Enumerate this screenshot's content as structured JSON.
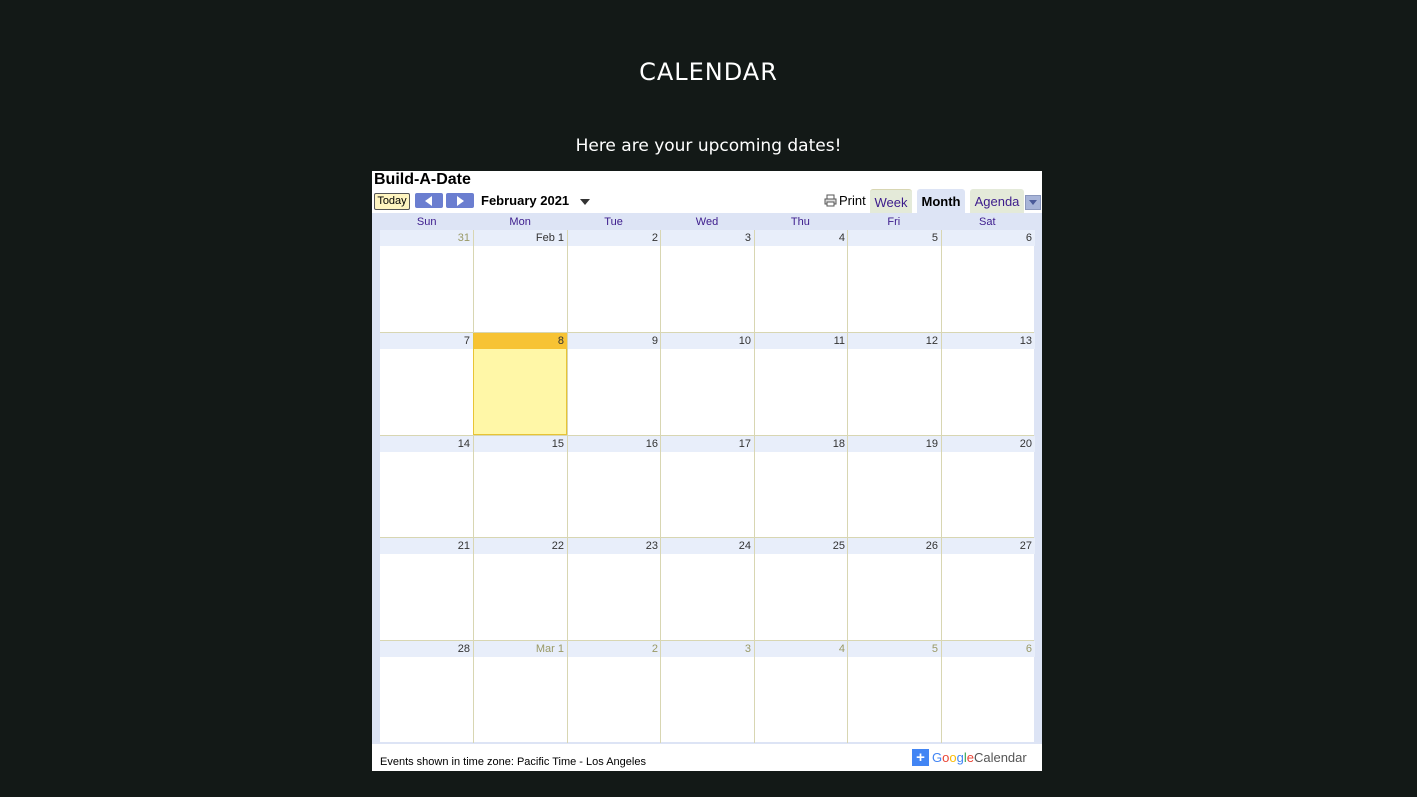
{
  "page": {
    "title": "CALENDAR",
    "subtitle": "Here are your upcoming dates!"
  },
  "calendar": {
    "name": "Build-A-Date",
    "today_label": "Today",
    "month_label": "February 2021",
    "print_label": "Print",
    "tabs": {
      "week": "Week",
      "month": "Month",
      "agenda": "Agenda"
    },
    "active_tab": "Month",
    "day_names": [
      "Sun",
      "Mon",
      "Tue",
      "Wed",
      "Thu",
      "Fri",
      "Sat"
    ],
    "weeks": [
      [
        {
          "label": "31",
          "other": true
        },
        {
          "label": "Feb 1",
          "other": false
        },
        {
          "label": "2",
          "other": false
        },
        {
          "label": "3",
          "other": false
        },
        {
          "label": "4",
          "other": false
        },
        {
          "label": "5",
          "other": false
        },
        {
          "label": "6",
          "other": false
        }
      ],
      [
        {
          "label": "7",
          "other": false
        },
        {
          "label": "8",
          "other": false,
          "today": true
        },
        {
          "label": "9",
          "other": false
        },
        {
          "label": "10",
          "other": false
        },
        {
          "label": "11",
          "other": false
        },
        {
          "label": "12",
          "other": false
        },
        {
          "label": "13",
          "other": false
        }
      ],
      [
        {
          "label": "14",
          "other": false
        },
        {
          "label": "15",
          "other": false
        },
        {
          "label": "16",
          "other": false
        },
        {
          "label": "17",
          "other": false
        },
        {
          "label": "18",
          "other": false
        },
        {
          "label": "19",
          "other": false
        },
        {
          "label": "20",
          "other": false
        }
      ],
      [
        {
          "label": "21",
          "other": false
        },
        {
          "label": "22",
          "other": false
        },
        {
          "label": "23",
          "other": false
        },
        {
          "label": "24",
          "other": false
        },
        {
          "label": "25",
          "other": false
        },
        {
          "label": "26",
          "other": false
        },
        {
          "label": "27",
          "other": false
        }
      ],
      [
        {
          "label": "28",
          "other": false
        },
        {
          "label": "Mar 1",
          "other": true
        },
        {
          "label": "2",
          "other": true
        },
        {
          "label": "3",
          "other": true
        },
        {
          "label": "4",
          "other": true
        },
        {
          "label": "5",
          "other": true
        },
        {
          "label": "6",
          "other": true
        }
      ]
    ],
    "timezone_text": "Events shown in time zone: Pacific Time - Los Angeles",
    "badge": {
      "google": [
        "G",
        "o",
        "o",
        "g",
        "l",
        "e"
      ],
      "calendar": "Calendar",
      "plus": "+"
    },
    "colors": {
      "accent": "#6b7ed0",
      "today_bg": "#fff7a7",
      "today_bar": "#f7c334",
      "header_bg": "#dde4f5"
    }
  }
}
